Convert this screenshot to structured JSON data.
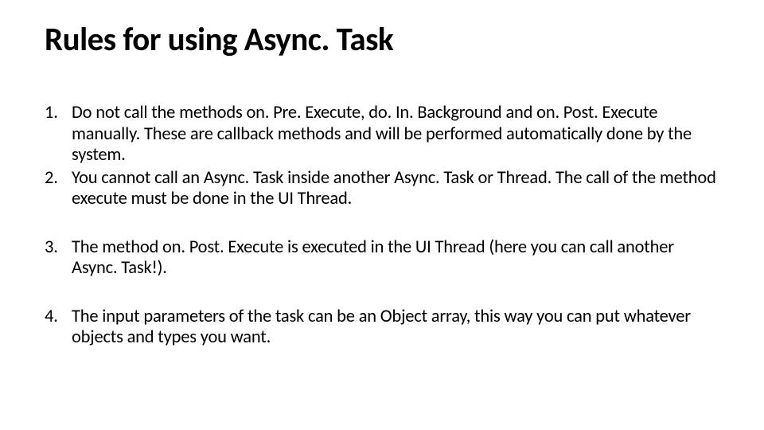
{
  "slide": {
    "title": "Rules for using Async. Task",
    "rules": [
      "Do not call the methods on. Pre. Execute, do. In. Background and on. Post. Execute manually. These are callback methods and will be performed automatically done by the system.",
      "You cannot call an Async. Task inside another Async. Task or Thread. The call of the method execute must be done in the UI Thread.",
      "The method on. Post. Execute is executed in the UI Thread (here you can call another Async. Task!).",
      "The input parameters of the task can be an Object array, this way you can put whatever objects and types you want."
    ]
  }
}
